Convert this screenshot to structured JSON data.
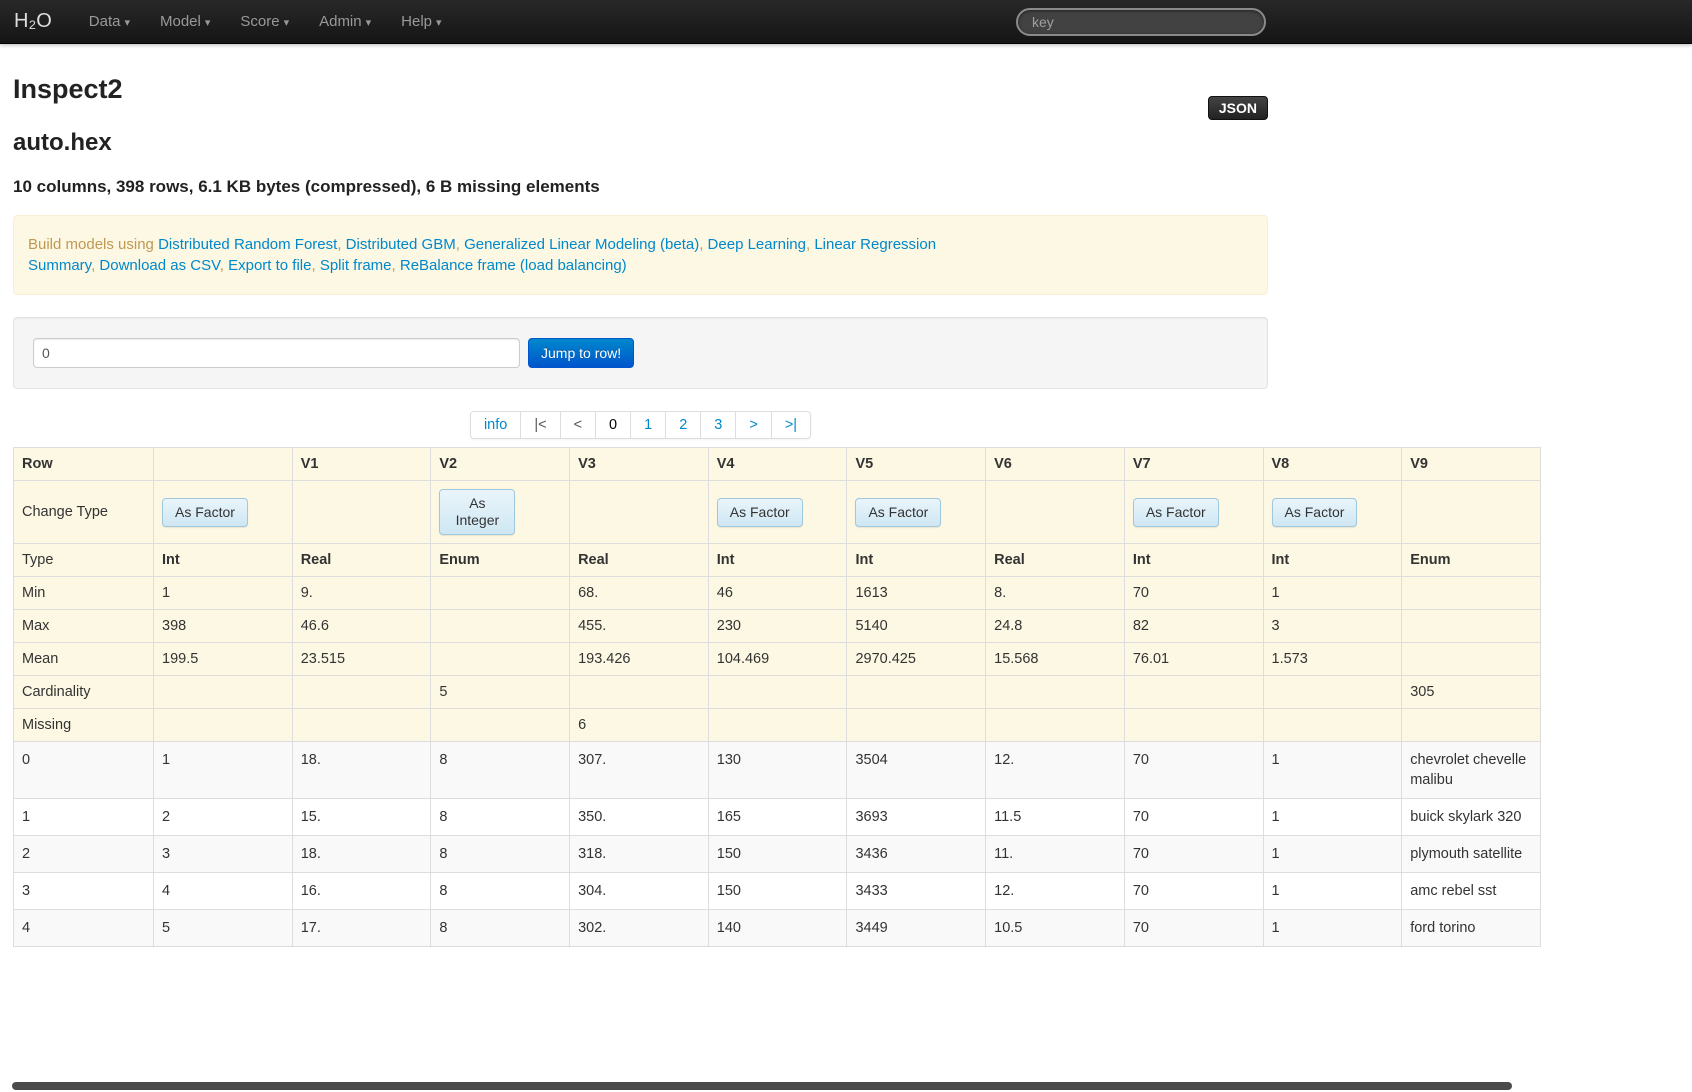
{
  "navbar": {
    "brand": "H₂O",
    "items": [
      {
        "label": "Data"
      },
      {
        "label": "Model"
      },
      {
        "label": "Score"
      },
      {
        "label": "Admin"
      },
      {
        "label": "Help"
      }
    ],
    "caret_icon": "▾",
    "search_placeholder": "key"
  },
  "page": {
    "title": "Inspect2",
    "json_button_label": "JSON",
    "frame_name": "auto.hex",
    "summary": "10 columns, 398 rows, 6.1 KB bytes (compressed), 6 B missing elements"
  },
  "actions": {
    "prefix": "Build models using",
    "model_links": [
      "Distributed Random Forest",
      "Distributed GBM",
      "Generalized Linear Modeling (beta)",
      "Deep Learning",
      "Linear Regression"
    ],
    "utility_links": [
      "Summary",
      "Download as CSV",
      "Export to file",
      "Split frame",
      "ReBalance frame (load balancing)"
    ]
  },
  "jump_to_row": {
    "value": "0",
    "button_label": "Jump to row!"
  },
  "pagination": {
    "items": [
      {
        "label": "info",
        "cls": "link"
      },
      {
        "label": "|<",
        "cls": "disabled"
      },
      {
        "label": "<",
        "cls": "disabled"
      },
      {
        "label": "0",
        "cls": "active"
      },
      {
        "label": "1",
        "cls": "link"
      },
      {
        "label": "2",
        "cls": "link"
      },
      {
        "label": "3",
        "cls": "link"
      },
      {
        "label": ">",
        "cls": "link"
      },
      {
        "label": ">|",
        "cls": "link"
      }
    ]
  },
  "table": {
    "row_header": "Row",
    "column_headers": [
      "",
      "V1",
      "V2",
      "V3",
      "V4",
      "V5",
      "V6",
      "V7",
      "V8",
      "V9"
    ],
    "change_type": {
      "label": "Change Type",
      "buttons": [
        "As Factor",
        "",
        "As Integer",
        "",
        "As Factor",
        "As Factor",
        "",
        "As Factor",
        "As Factor",
        ""
      ]
    },
    "stats": [
      {
        "label": "Type",
        "cls": "bold-vals",
        "values": [
          "Int",
          "Real",
          "Enum",
          "Real",
          "Int",
          "Int",
          "Real",
          "Int",
          "Int",
          "Enum"
        ]
      },
      {
        "label": "Min",
        "values": [
          "1",
          "9.",
          "",
          "68.",
          "46",
          "1613",
          "8.",
          "70",
          "1",
          ""
        ]
      },
      {
        "label": "Max",
        "values": [
          "398",
          "46.6",
          "",
          "455.",
          "230",
          "5140",
          "24.8",
          "82",
          "3",
          ""
        ]
      },
      {
        "label": "Mean",
        "values": [
          "199.5",
          "23.515",
          "",
          "193.426",
          "104.469",
          "2970.425",
          "15.568",
          "76.01",
          "1.573",
          ""
        ]
      },
      {
        "label": "Cardinality",
        "values": [
          "",
          "",
          "5",
          "",
          "",
          "",
          "",
          "",
          "",
          "305"
        ]
      },
      {
        "label": "Missing",
        "values": [
          "",
          "",
          "",
          "6",
          "",
          "",
          "",
          "",
          "",
          ""
        ]
      }
    ],
    "rows": [
      {
        "label": "0",
        "values": [
          "1",
          "18.",
          "8",
          "307.",
          "130",
          "3504",
          "12.",
          "70",
          "1",
          "chevrolet chevelle malibu"
        ]
      },
      {
        "label": "1",
        "values": [
          "2",
          "15.",
          "8",
          "350.",
          "165",
          "3693",
          "11.5",
          "70",
          "1",
          "buick skylark 320"
        ]
      },
      {
        "label": "2",
        "values": [
          "3",
          "18.",
          "8",
          "318.",
          "150",
          "3436",
          "11.",
          "70",
          "1",
          "plymouth satellite"
        ]
      },
      {
        "label": "3",
        "values": [
          "4",
          "16.",
          "8",
          "304.",
          "150",
          "3433",
          "12.",
          "70",
          "1",
          "amc rebel sst"
        ]
      },
      {
        "label": "4",
        "values": [
          "5",
          "17.",
          "8",
          "302.",
          "140",
          "3449",
          "10.5",
          "70",
          "1",
          "ford torino"
        ]
      }
    ]
  },
  "colors": {
    "link_blue": "#0088cc",
    "primary_button": "#0074cc",
    "alert_background": "#fcf8e3",
    "alert_text": "#c09853",
    "highlight_row": "#fcf8e3",
    "navbar_background": "#1b1b1b",
    "change_type_button": "#d9edf7"
  }
}
